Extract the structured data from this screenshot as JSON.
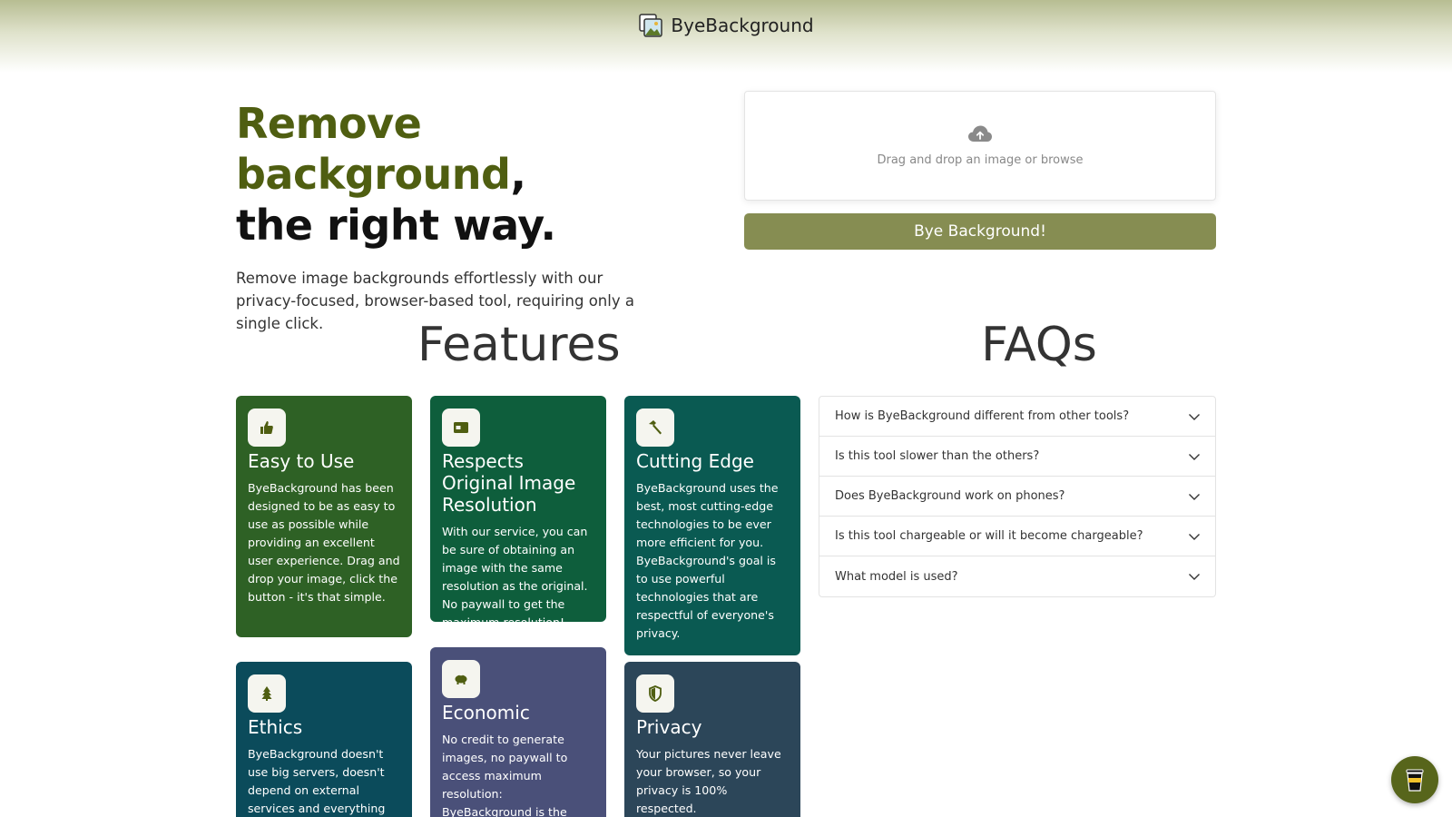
{
  "header": {
    "brand": "ByeBackground"
  },
  "hero": {
    "title_accent": "Remove background",
    "title_comma": ",",
    "title_line2": "the right way.",
    "subtitle": "Remove image backgrounds effortlessly with our privacy-focused, browser-based tool, requiring only a single click."
  },
  "upload": {
    "drop_text": "Drag and drop an image or browse",
    "button_label": "Bye Background!"
  },
  "features": {
    "title": "Features",
    "cards": [
      {
        "icon": "thumbs-up-icon",
        "title": "Easy to Use",
        "text": "ByeBackground has been designed to be as easy to use as possible while providing an excellent user experience. Drag and drop your image, click the button - it's that simple.",
        "color": "#2e6125"
      },
      {
        "icon": "image-icon",
        "title": "Respects Original Image Resolution",
        "text": "With our service, you can be sure of obtaining an image with the same resolution as the original. No paywall to get the maximum resolution!",
        "color": "#0e5e3c"
      },
      {
        "icon": "hammer-icon",
        "title": "Cutting Edge",
        "text": "ByeBackground uses the best, most cutting-edge technologies to be ever more efficient for you. ByeBackground's goal is to use powerful technologies that are respectful of everyone's privacy.",
        "color": "#0a5a52"
      },
      {
        "icon": "tree-icon",
        "title": "Ethics",
        "text": "ByeBackground doesn't use big servers, doesn't depend on external services and everything",
        "color": "#0b4b5b"
      },
      {
        "icon": "piggy-bank-icon",
        "title": "Economic",
        "text": "No credit to generate images, no paywall to access maximum resolution: ByeBackground is the",
        "color": "#4a5079"
      },
      {
        "icon": "shield-icon",
        "title": "Privacy",
        "text": "Your pictures never leave your browser, so your privacy is 100% respected.",
        "color": "#2c4659"
      }
    ]
  },
  "faqs": {
    "title": "FAQs",
    "items": [
      "How is ByeBackground different from other tools?",
      "Is this tool slower than the others?",
      "Does ByeBackground work on phones?",
      "Is this tool chargeable or will it become chargeable?",
      "What model is used?"
    ]
  },
  "colors": {
    "accent": "#4f5e11",
    "button": "#868d52",
    "coffee_button": "#57651b"
  },
  "floating": {
    "icon": "coffee-cup-icon"
  }
}
